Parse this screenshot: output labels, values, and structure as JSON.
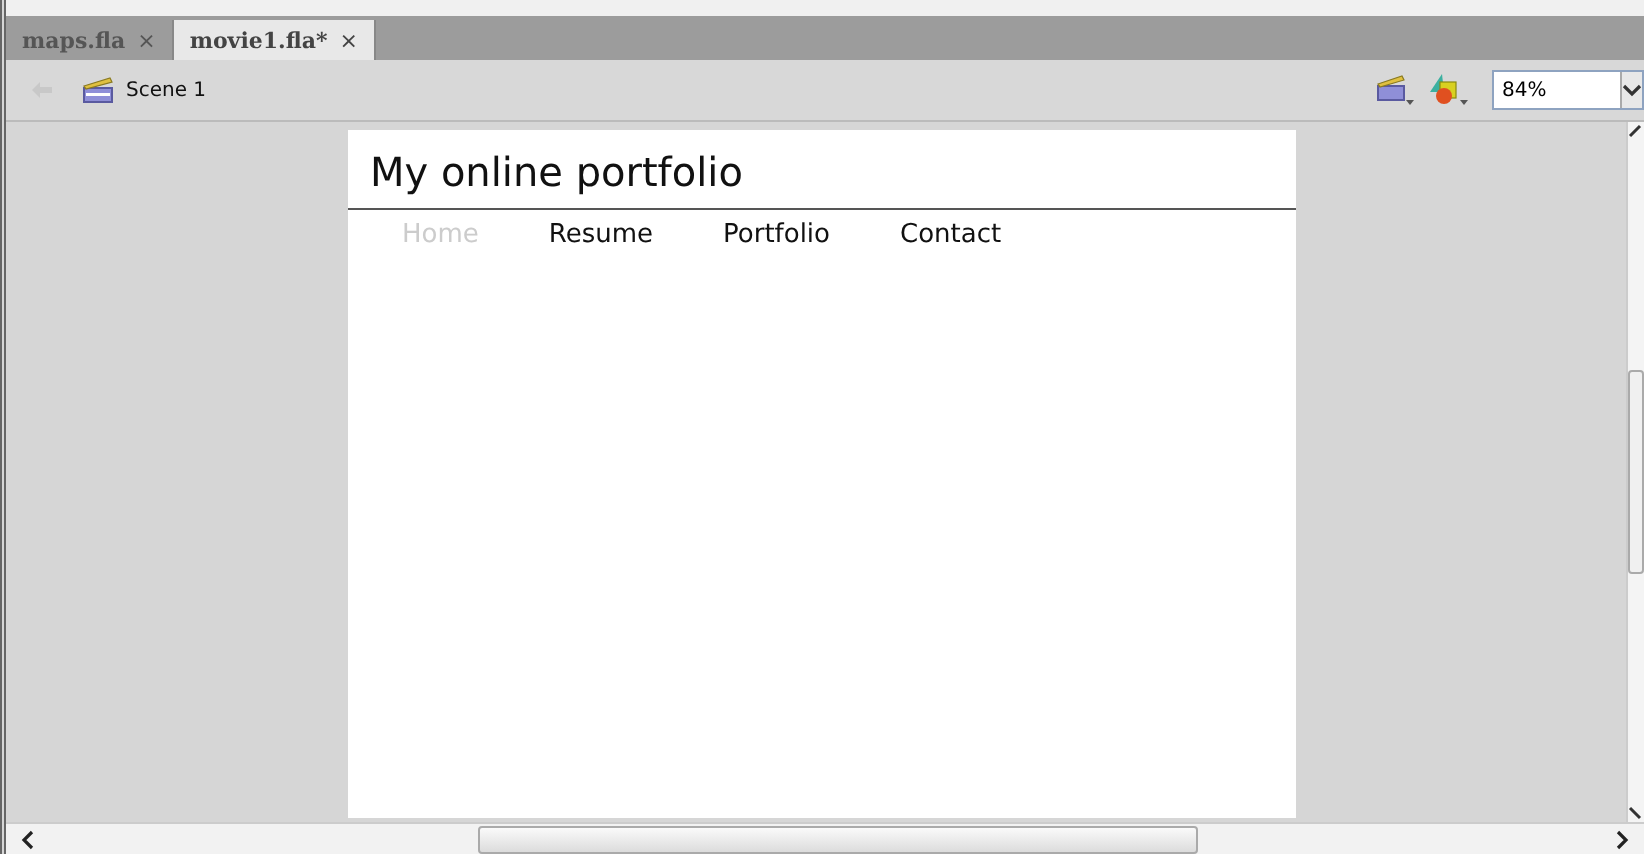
{
  "tabs": [
    {
      "label": "maps.fla",
      "close": "×",
      "selected": false
    },
    {
      "label": "movie1.fla*",
      "close": "×",
      "selected": true
    }
  ],
  "toolbar": {
    "scene": "Scene 1",
    "zoom": "84%"
  },
  "stage": {
    "title": "My online portfolio",
    "nav": [
      {
        "label": "Home",
        "selected": true
      },
      {
        "label": "Resume",
        "selected": false
      },
      {
        "label": "Portfolio",
        "selected": false
      },
      {
        "label": "Contact",
        "selected": false
      }
    ]
  }
}
